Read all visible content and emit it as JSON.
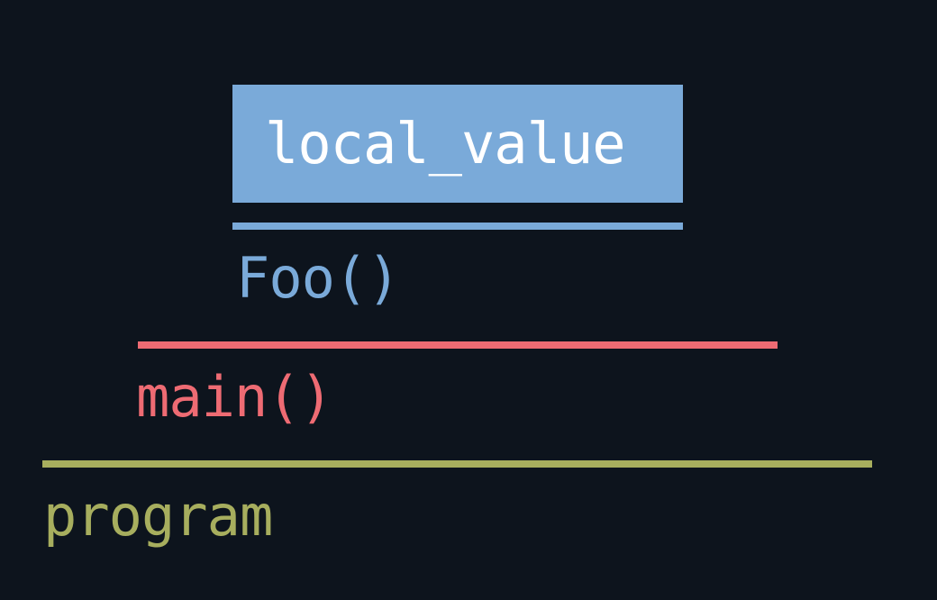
{
  "colors": {
    "background": "#0d141d",
    "blue": "#7aaad9",
    "red": "#ee6b73",
    "olive": "#a7ae5e",
    "box_text": "#ffffff"
  },
  "stack": {
    "variable": {
      "label": "local_value"
    },
    "frames": [
      {
        "label": "Foo()"
      },
      {
        "label": "main()"
      },
      {
        "label": "program"
      }
    ]
  }
}
